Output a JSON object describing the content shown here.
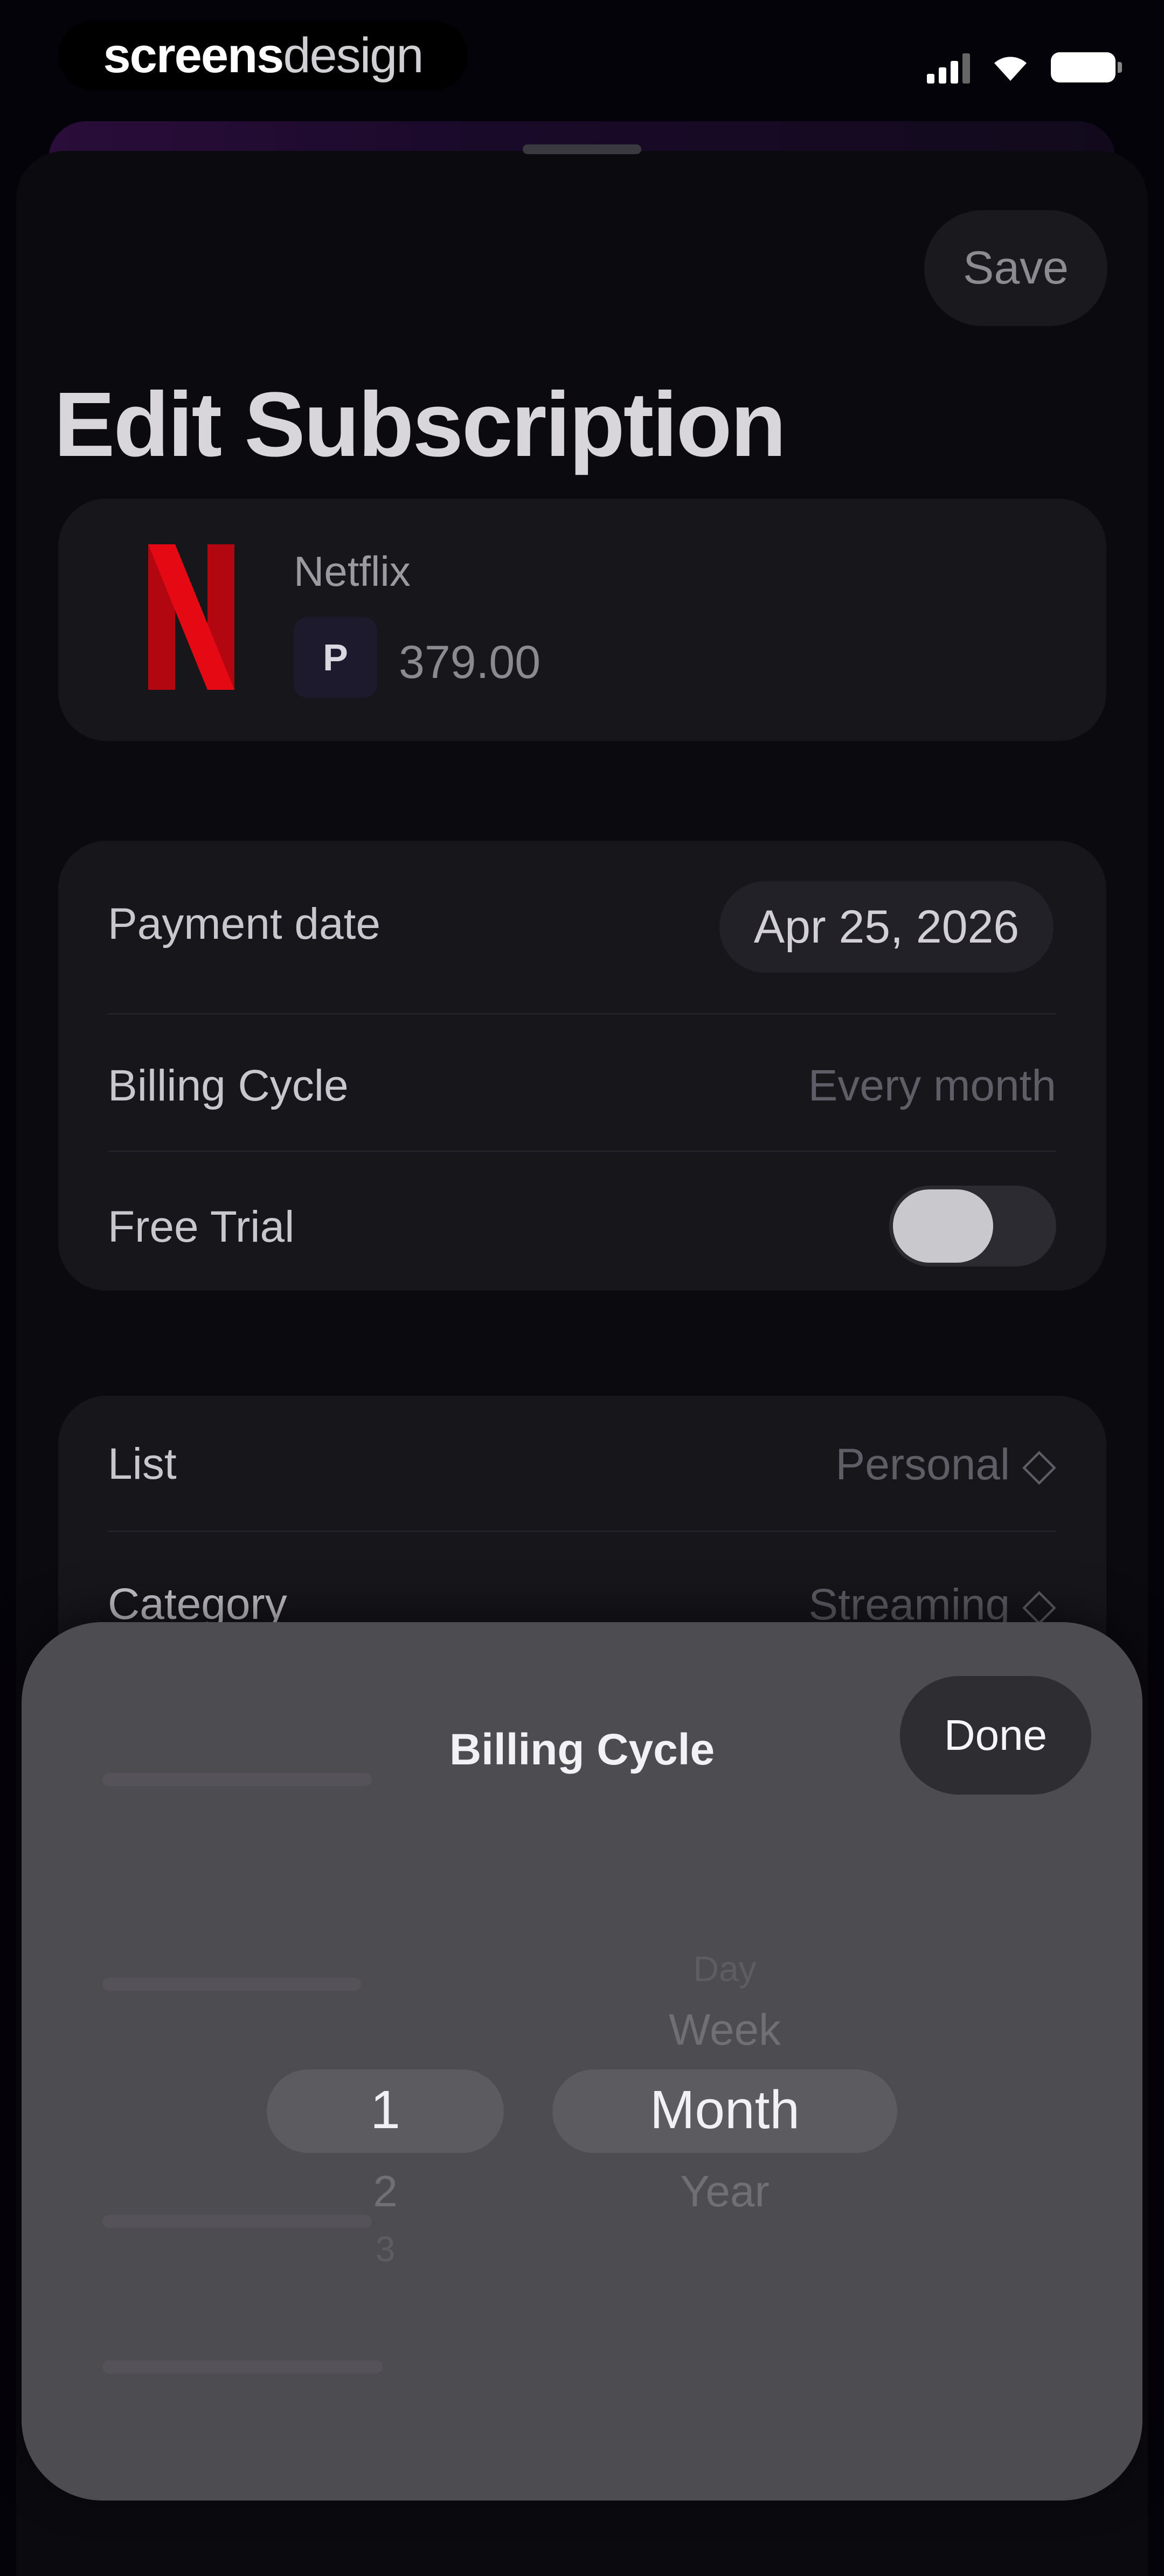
{
  "status_bar": {
    "watermark_part1": "screens",
    "watermark_part2": "design"
  },
  "header": {
    "save_label": "Save",
    "title": "Edit Subscription"
  },
  "service": {
    "name": "Netflix",
    "currency_symbol": "P",
    "price": "379.00",
    "brand_color": "#b20710"
  },
  "payment": {
    "date_label": "Payment date",
    "date_value": "Apr 25, 2026",
    "cycle_label": "Billing Cycle",
    "cycle_value": "Every month",
    "trial_label": "Free Trial",
    "trial_on": false
  },
  "details": {
    "list_label": "List",
    "list_value": "Personal ◇",
    "category_label": "Category",
    "category_value": "Streaming ◇"
  },
  "picker_sheet": {
    "title": "Billing Cycle",
    "done_label": "Done",
    "numbers": {
      "selected": "1",
      "next1": "2",
      "next2": "3"
    },
    "units": {
      "prev2": "Day",
      "prev1": "Week",
      "selected": "Month",
      "next1": "Year"
    }
  }
}
